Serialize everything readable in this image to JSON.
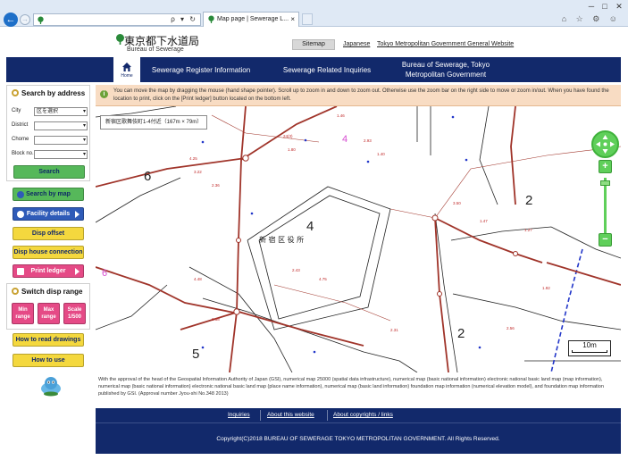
{
  "browser": {
    "tab_title": "Map page | Sewerage L...",
    "window_controls": [
      "─",
      "□",
      "✕"
    ],
    "addr_tools": "ρ ▾ ↻"
  },
  "header": {
    "logo_jp": "東京都下水道局",
    "logo_en": "Bureau of Sewerage",
    "sitemap": "Sitemap",
    "link_japanese": "Japanese",
    "link_tmg": "Tokyo Metropolitan Government General Website"
  },
  "nav": {
    "home": "Home",
    "items": [
      "Sewerage Register Information",
      "Sewerage Related Inquiries",
      "Bureau of Sewerage, Tokyo Metropolitan Government"
    ]
  },
  "sidebar": {
    "search_title": "Search by address",
    "fields": [
      {
        "label": "City",
        "value": "区を選択"
      },
      {
        "label": "District",
        "value": ""
      },
      {
        "label": "Chome",
        "value": ""
      },
      {
        "label": "Block no.",
        "value": ""
      }
    ],
    "search_button": "Search",
    "search_by_map": "Search by map",
    "facility_details": "Facility details",
    "disp_offset": "Disp offset",
    "disp_house_connection": "Disp house connection",
    "print_ledger": "Print ledger",
    "switch_title": "Switch disp range",
    "range_min": "Min range",
    "range_max": "Max range",
    "range_scale": "Scale 1/500",
    "how_to_read": "How to read drawings",
    "how_to_use": "How to use"
  },
  "info": {
    "message": "You can move the map by dragging the mouse (hand shape pointer). Scroll up to zoom in and down to zoom out. Otherwise use the zoom bar on the right side to move or zoom in/out. When you have found the location to print, click on the [Print ledger] button located on the bottom left."
  },
  "map": {
    "location_label": "新宿区歌舞伎町1-4付近（167m × 79m）",
    "scale_label": "10m",
    "block_numbers": [
      "6",
      "4",
      "2",
      "5",
      "2",
      "4",
      "6"
    ],
    "building_label": "新 宿 区 役 所",
    "zoom_in": "+",
    "zoom_out": "−"
  },
  "credit": "With the approval of the head of the Geospatial Information Authority of Japan (GSI), numerical map 25000 (spatial data infrastructure), numerical map (basic national information) electronic national basic land map (map information), numerical map (basic national information) electronic national basic land map (place name information), numerical map (basic land information) foundation map information (numerical elevation model), and foundation map information published by GSI. (Approval number Jyou-shi No.348 2013)",
  "footer": {
    "links": [
      "Inquiries",
      "About this website",
      "About copyrights / links"
    ],
    "copyright": "Copyright(C)2018 BUREAU OF SEWERAGE TOKYO METROPOLITAN GOVERNMENT. All Rights Reserved."
  },
  "colors": {
    "navy": "#12296b",
    "pipe_red": "#a0342a",
    "zoom_green": "#5fcf5a"
  }
}
